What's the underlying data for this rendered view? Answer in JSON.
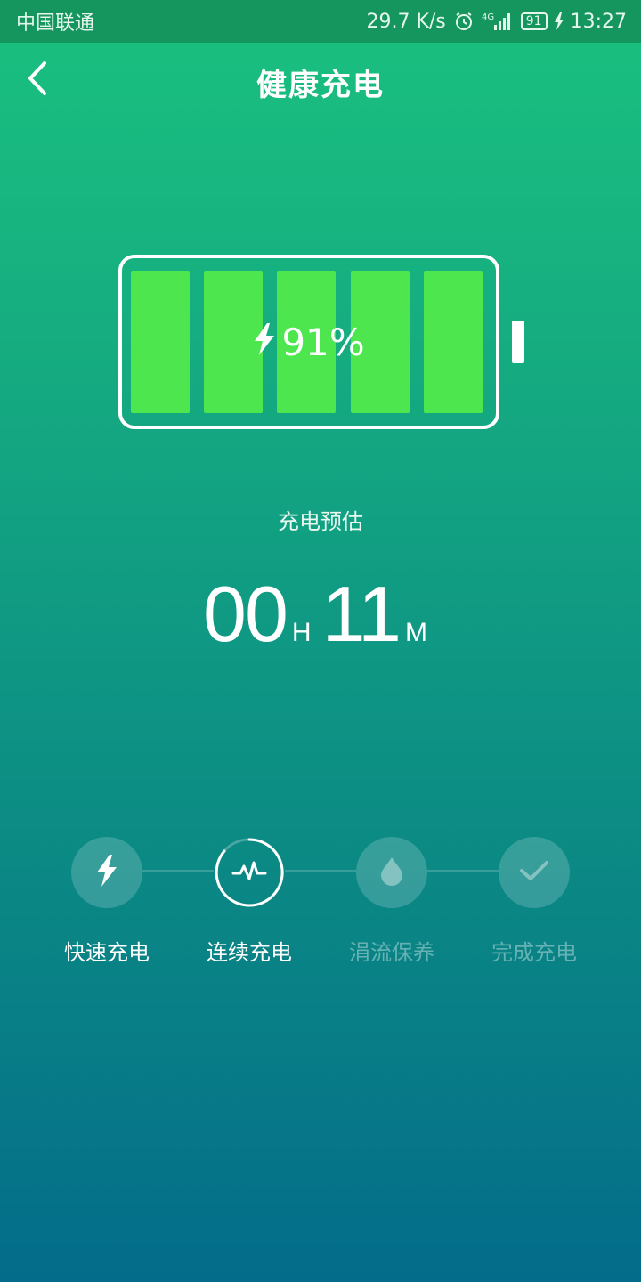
{
  "status_bar": {
    "carrier": "中国联通",
    "net_speed": "29.7 K/s",
    "network": "4G",
    "battery_level": "91",
    "time": "13:27"
  },
  "header": {
    "title": "健康充电",
    "back_icon": "chevron-left-icon"
  },
  "battery": {
    "percent": "91%",
    "level_fraction": 0.91,
    "cell_color": "#4ee64e",
    "icon": "lightning-icon"
  },
  "estimate": {
    "label": "充电预估",
    "hours": "00",
    "hours_unit": "H",
    "minutes": "11",
    "minutes_unit": "M"
  },
  "steps": [
    {
      "label": "快速充电",
      "icon": "lightning-icon",
      "state": "done"
    },
    {
      "label": "连续充电",
      "icon": "pulse-icon",
      "state": "current"
    },
    {
      "label": "涓流保养",
      "icon": "droplet-icon",
      "state": "pending"
    },
    {
      "label": "完成充电",
      "icon": "check-icon",
      "state": "pending"
    }
  ],
  "colors": {
    "gradient_top": "#1ac17f",
    "gradient_bottom": "#036c8a",
    "status_bar": "#15965e"
  }
}
